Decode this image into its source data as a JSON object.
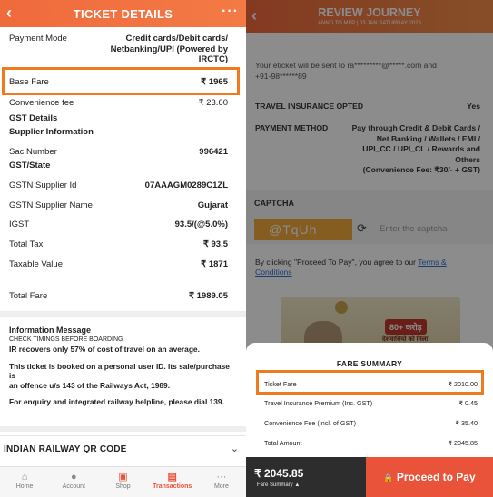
{
  "left": {
    "header": {
      "title": "TICKET DETAILS",
      "back": "‹",
      "more": "···"
    },
    "payment_mode": {
      "label": "Payment Mode",
      "value_line1": "Credit cards/Debit cards/",
      "value_line2": "Netbanking/UPI (Powered by",
      "value_line3": "IRCTC)"
    },
    "base_fare": {
      "label": "Base Fare",
      "value": "₹ 1965"
    },
    "convenience_fee": {
      "label": "Convenience fee",
      "value": "₹ 23.60"
    },
    "gst_details": "GST Details",
    "supplier_information": "Supplier Information",
    "sac_number": {
      "label": "Sac Number",
      "value": "996421"
    },
    "gst_state": "GST/State",
    "gstn_supplier_id": {
      "label": "GSTN Supplier Id",
      "value": "07AAAGM0289C1ZL"
    },
    "gstn_supplier_name": {
      "label": "GSTN Supplier Name",
      "value": "Gujarat"
    },
    "igst": {
      "label": "IGST",
      "value": "93.5/(@5.0%)"
    },
    "total_tax": {
      "label": "Total Tax",
      "value": "₹ 93.5"
    },
    "taxable_value": {
      "label": "Taxable Value",
      "value": "₹ 1871"
    },
    "total_fare": {
      "label": "Total Fare",
      "value": "₹ 1989.05"
    },
    "info": {
      "heading": "Information Message",
      "check": "CHECK TIMINGS BEFORE BOARDING",
      "line1": "IR recovers only 57% of cost of travel on an average.",
      "line2a": "This ticket is booked on a personal user ID. Its sale/purchase is",
      "line2b": "an offence u/s 143 of the Railways Act, 1989.",
      "line3": "For enquiry and integrated railway helpline, please dial 139."
    },
    "qr_section": {
      "title": "INDIAN RAILWAY QR CODE"
    },
    "nav": [
      {
        "label": "Home",
        "icon": "home-icon",
        "glyph": "⌂"
      },
      {
        "label": "Account",
        "icon": "account-icon",
        "glyph": "●"
      },
      {
        "label": "Shop",
        "icon": "shop-icon",
        "glyph": "▣"
      },
      {
        "label": "Transactions",
        "icon": "transactions-icon",
        "glyph": "▤"
      },
      {
        "label": "More",
        "icon": "more-icon",
        "glyph": "···"
      }
    ]
  },
  "right": {
    "header": {
      "title": "REVIEW JOURNEY",
      "subtitle": "ANND TO MFP | 03 JAN SATURDAY 2026",
      "back": "‹"
    },
    "ticket_sent_line1": "Your eticket will be sent to ra*********@*****.com and",
    "ticket_sent_line2": "+91-98******89",
    "insurance": {
      "label": "TRAVEL INSURANCE OPTED",
      "value": "Yes"
    },
    "payment_method": {
      "label": "PAYMENT METHOD",
      "value_lines": [
        "Pay through Credit & Debit Cards /",
        "Net Banking / Wallets / EMI /",
        "UPI_CC / UPI_CL / Rewards and",
        "Others",
        "(Convenience Fee: ₹30/- + GST)"
      ]
    },
    "captcha": {
      "label": "CAPTCHA",
      "image_text": "@TqUh",
      "placeholder": "Enter the captcha",
      "refresh_glyph": "⟳"
    },
    "agree_text": "By clicking \"Proceed To Pay\", you agree to our",
    "agree_link": "Terms & Conditions",
    "banner": {
      "tag": "80+ करोड़",
      "hindi": "देशवासियों को मिला"
    },
    "fare_summary": {
      "title": "FARE SUMMARY",
      "rows": [
        {
          "label": "Ticket Fare",
          "value": "₹ 2010.00"
        },
        {
          "label": "Travel Insurance Premium (Inc. GST)",
          "value": "₹ 0.45"
        },
        {
          "label": "Convenience Fee (Incl. of GST)",
          "value": "₹ 35.40"
        },
        {
          "label": "Total Amount",
          "value": "₹ 2045.85"
        }
      ]
    },
    "pay_bar": {
      "amount": "₹ 2045.85",
      "fare_summary_label": "Fare Summary",
      "caret": "▲",
      "button": "Proceed to Pay",
      "lock_glyph": "🔒"
    }
  },
  "colors": {
    "brand_orange": "#f06a3c",
    "pay_button": "#e9533a",
    "highlight": "#f07a1e",
    "link": "#2a6fd6"
  }
}
